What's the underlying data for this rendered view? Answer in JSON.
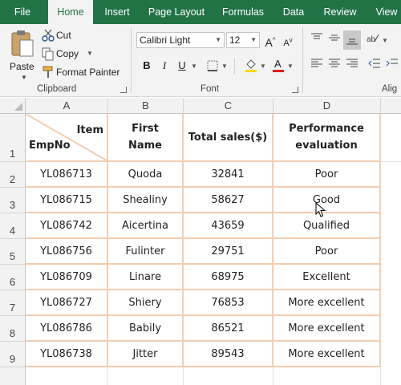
{
  "ribbon": {
    "tabs": [
      {
        "label": "File",
        "active": false
      },
      {
        "label": "Home",
        "active": true
      },
      {
        "label": "Insert",
        "active": false
      },
      {
        "label": "Page Layout",
        "active": false
      },
      {
        "label": "Formulas",
        "active": false
      },
      {
        "label": "Data",
        "active": false
      },
      {
        "label": "Review",
        "active": false
      },
      {
        "label": "View",
        "active": false
      }
    ],
    "clipboard": {
      "paste_label": "Paste",
      "cut_label": "Cut",
      "copy_label": "Copy",
      "format_painter_label": "Format Painter",
      "group_label": "Clipboard"
    },
    "font": {
      "font_name": "Calibri Light",
      "font_size": "12",
      "group_label": "Font",
      "bold": "B",
      "italic": "I",
      "underline": "U"
    },
    "alignment": {
      "group_label": "Alig"
    }
  },
  "colors": {
    "ribbon_green": "#217346",
    "ribbon_bg": "#f3f3f3",
    "table_border": "#f4cdb0",
    "fill_color": "#ffd700",
    "font_color": "#e01b1b"
  },
  "sheet": {
    "columns": [
      "A",
      "B",
      "C",
      "D"
    ],
    "row_numbers": [
      "1",
      "2",
      "3",
      "4",
      "5",
      "6",
      "7",
      "8",
      "9"
    ],
    "header": {
      "diagonal_top": "Item",
      "diagonal_bottom": "EmpNo",
      "first_name": "First Name",
      "total_sales": "Total sales($)",
      "performance": "Performance evaluation"
    },
    "rows": [
      [
        "YL086713",
        "Quoda",
        "32841",
        "Poor"
      ],
      [
        "YL086715",
        "Shealiny",
        "58627",
        "Good"
      ],
      [
        "YL086742",
        "Aicertina",
        "43659",
        "Qualified"
      ],
      [
        "YL086756",
        "Fulinter",
        "29751",
        "Poor"
      ],
      [
        "YL086709",
        "Linare",
        "68975",
        "Excellent"
      ],
      [
        "YL086727",
        "Shiery",
        "76853",
        "More excellent"
      ],
      [
        "YL086786",
        "Babily",
        "86521",
        "More excellent"
      ],
      [
        "YL086738",
        "Jitter",
        "89543",
        "More excellent"
      ]
    ]
  }
}
